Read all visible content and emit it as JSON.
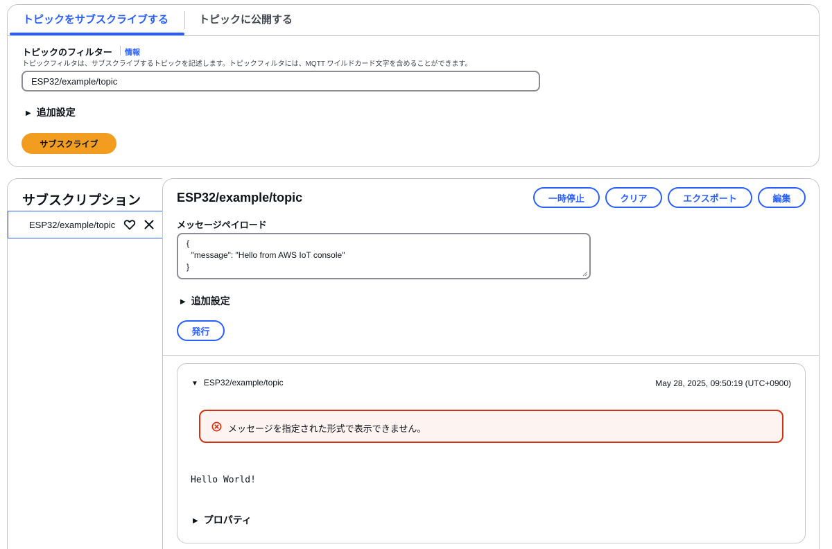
{
  "tabs": {
    "subscribe": "トピックをサブスクライブする",
    "publish": "トピックに公開する"
  },
  "filter": {
    "label": "トピックのフィルター",
    "info": "情報",
    "description": "トピックフィルタは、サブスクライブするトピックを記述します。トピックフィルタには、MQTT ワイルドカード文字を含めることができます。",
    "value": "ESP32/example/topic",
    "additional_settings": "追加設定",
    "subscribe_button": "サブスクライブ"
  },
  "subscriptions": {
    "title": "サブスクリプション",
    "items": [
      {
        "label": "ESP32/example/topic"
      }
    ]
  },
  "main": {
    "topic": "ESP32/example/topic",
    "buttons": {
      "pause": "一時停止",
      "clear": "クリア",
      "export": "エクスポート",
      "edit": "編集"
    },
    "payload_label": "メッセージペイロード",
    "payload_value": "{\n  \"message\": \"Hello from AWS IoT console\"\n}",
    "additional_settings": "追加設定",
    "publish_button": "発行"
  },
  "message": {
    "topic": "ESP32/example/topic",
    "timestamp": "May 28, 2025, 09:50:19 (UTC+0900)",
    "error": "メッセージを指定された形式で表示できません。",
    "body": "Hello World!",
    "properties": "プロパティ"
  },
  "colors": {
    "accent": "#295eff",
    "primary_button": "#f29d1f",
    "error": "#d13212"
  },
  "icons": {
    "expand": "caret-right-icon",
    "collapse": "caret-down-icon",
    "favorite": "heart-icon",
    "remove": "close-icon",
    "error": "error-circle-icon"
  }
}
